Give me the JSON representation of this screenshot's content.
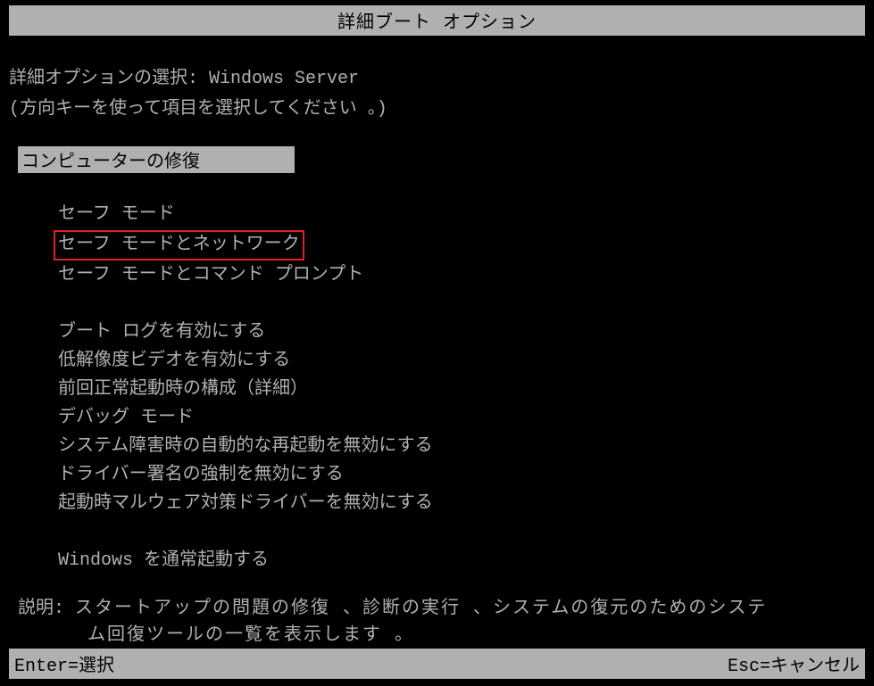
{
  "title": "詳細ブート オプション",
  "selectionPrompt": "詳細オプションの選択:",
  "osName": "Windows Server",
  "instruction": "(方向キーを使って項目を選択してください 。)",
  "selectedOption": "コンピューターの修復",
  "options": {
    "group1": [
      "セーフ モード",
      "セーフ モードとネットワーク",
      "セーフ モードとコマンド プロンプト"
    ],
    "group2": [
      "ブート ログを有効にする",
      "低解像度ビデオを有効にする",
      "前回正常起動時の構成（詳細）",
      "デバッグ モード",
      "システム障害時の自動的な再起動を無効にする",
      "ドライバー署名の強制を無効にする",
      "起動時マルウェア対策ドライバーを無効にする"
    ],
    "group3": [
      "Windows を通常起動する"
    ]
  },
  "highlightedIndex": 1,
  "descriptionLabel": "説明:",
  "descriptionLine1": "スタートアップの問題の修復 、診断の実行 、システムの復元のためのシステ",
  "descriptionLine2": "ム回復ツールの一覧を表示します 。",
  "footer": {
    "enter": "Enter=選択",
    "esc": "Esc=キャンセル"
  }
}
